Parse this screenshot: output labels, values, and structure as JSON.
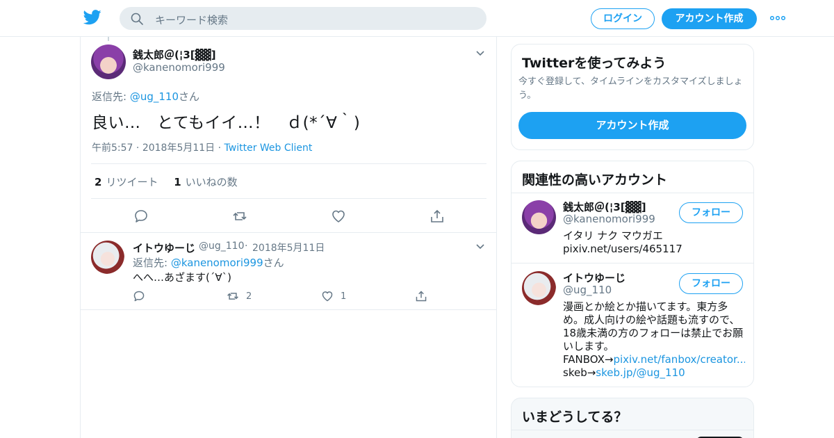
{
  "nav": {
    "search_placeholder": "キーワード検索",
    "login": "ログイン",
    "signup": "アカウント作成"
  },
  "main_tweet": {
    "name": "銭太郎＠(¦3[▓▓]",
    "handle": "@kanenomori999",
    "reply_prefix": "返信先: ",
    "reply_to": "@ug_110",
    "reply_suffix": "さん",
    "text": "良い…　とてもイイ…！　ｄ(*´∀｀)",
    "time": "午前5:57",
    "date": "2018年5月11日",
    "source": "Twitter Web Client",
    "retweets_count": "2",
    "retweets_label": "リツイート",
    "likes_count": "1",
    "likes_label": "いいねの数"
  },
  "reply_tweet": {
    "name": "イトウゆーじ",
    "handle": "@ug_110",
    "date": "2018年5月11日",
    "reply_prefix": "返信先: ",
    "reply_to": "@kanenomori999",
    "reply_suffix": "さん",
    "text": "へへ…あざます(´∀`)",
    "retweets": "2",
    "likes": "1"
  },
  "sidebar": {
    "signup_title": "Twitterを使ってみよう",
    "signup_desc": "今すぐ登録して、タイムラインをカスタマイズしましょう。",
    "signup_button": "アカウント作成",
    "related_title": "関連性の高いアカウント",
    "follow_label": "フォロー",
    "accounts": [
      {
        "name": "銭太郎＠(¦3[▓▓]",
        "handle": "@kanenomori999",
        "bio": "イタリ ナク マウガエ",
        "link": "pixiv.net/users/465117"
      },
      {
        "name": "イトウゆーじ",
        "handle": "@ug_110",
        "bio": "漫画とか絵とか描いてます。東方多め。成人向けの絵や話題も流すので、18歳未満の方のフォローは禁止でお願いします。",
        "fanbox_prefix": "FANBOX→",
        "fanbox_link": "pixiv.net/fanbox/creator...",
        "skeb_prefix": "skeb→",
        "skeb_link": "skeb.jp/@ug_110"
      }
    ],
    "trends_title": "いまどうしてる？"
  },
  "colors": {
    "accent": "#1da1f2",
    "link": "#1b95e0",
    "muted": "#657786",
    "border": "#e6ecf0"
  }
}
